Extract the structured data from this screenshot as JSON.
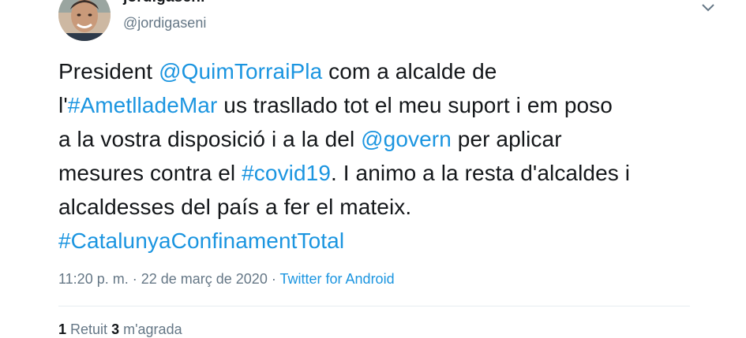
{
  "author": {
    "display_name": "jordigaseni",
    "handle": "@jordigaseni",
    "avatar_icon": "person-photo-avatar"
  },
  "tweet": {
    "segments": [
      {
        "text": "President ",
        "link": false
      },
      {
        "text": "@QuimTorraiPla",
        "link": true
      },
      {
        "text": " com a alcalde de",
        "link": false
      },
      {
        "text": "l'",
        "link": false
      },
      {
        "text": "#AmetlladeMar",
        "link": true
      },
      {
        "text": " us trasllado tot el meu suport i em poso",
        "link": false
      },
      {
        "text": "a la vostra disposició i a la del ",
        "link": false
      },
      {
        "text": "@govern",
        "link": true
      },
      {
        "text": " per aplicar",
        "link": false
      },
      {
        "text": "mesures contra el ",
        "link": false
      },
      {
        "text": "#covid19",
        "link": true
      },
      {
        "text": ". I animo a la resta d'alcaldes i",
        "link": false
      },
      {
        "text": "alcaldesses del país a fer el mateix.",
        "link": false
      },
      {
        "text": "#CatalunyaConfinamentTotal",
        "link": true
      }
    ]
  },
  "meta": {
    "time": "11:20 p. m.",
    "separator1": " · ",
    "date": "22 de març de 2020",
    "separator2": " · ",
    "source": "Twitter for Android"
  },
  "stats": {
    "retweets_count": "1",
    "retweets_label": "Retuit",
    "separator": " ",
    "likes_count": "3",
    "likes_label": "m'agrada"
  },
  "colors": {
    "link": "#1b95e0",
    "secondary_text": "#657786",
    "primary_text": "#14171a",
    "divider": "#e6ecf0"
  }
}
